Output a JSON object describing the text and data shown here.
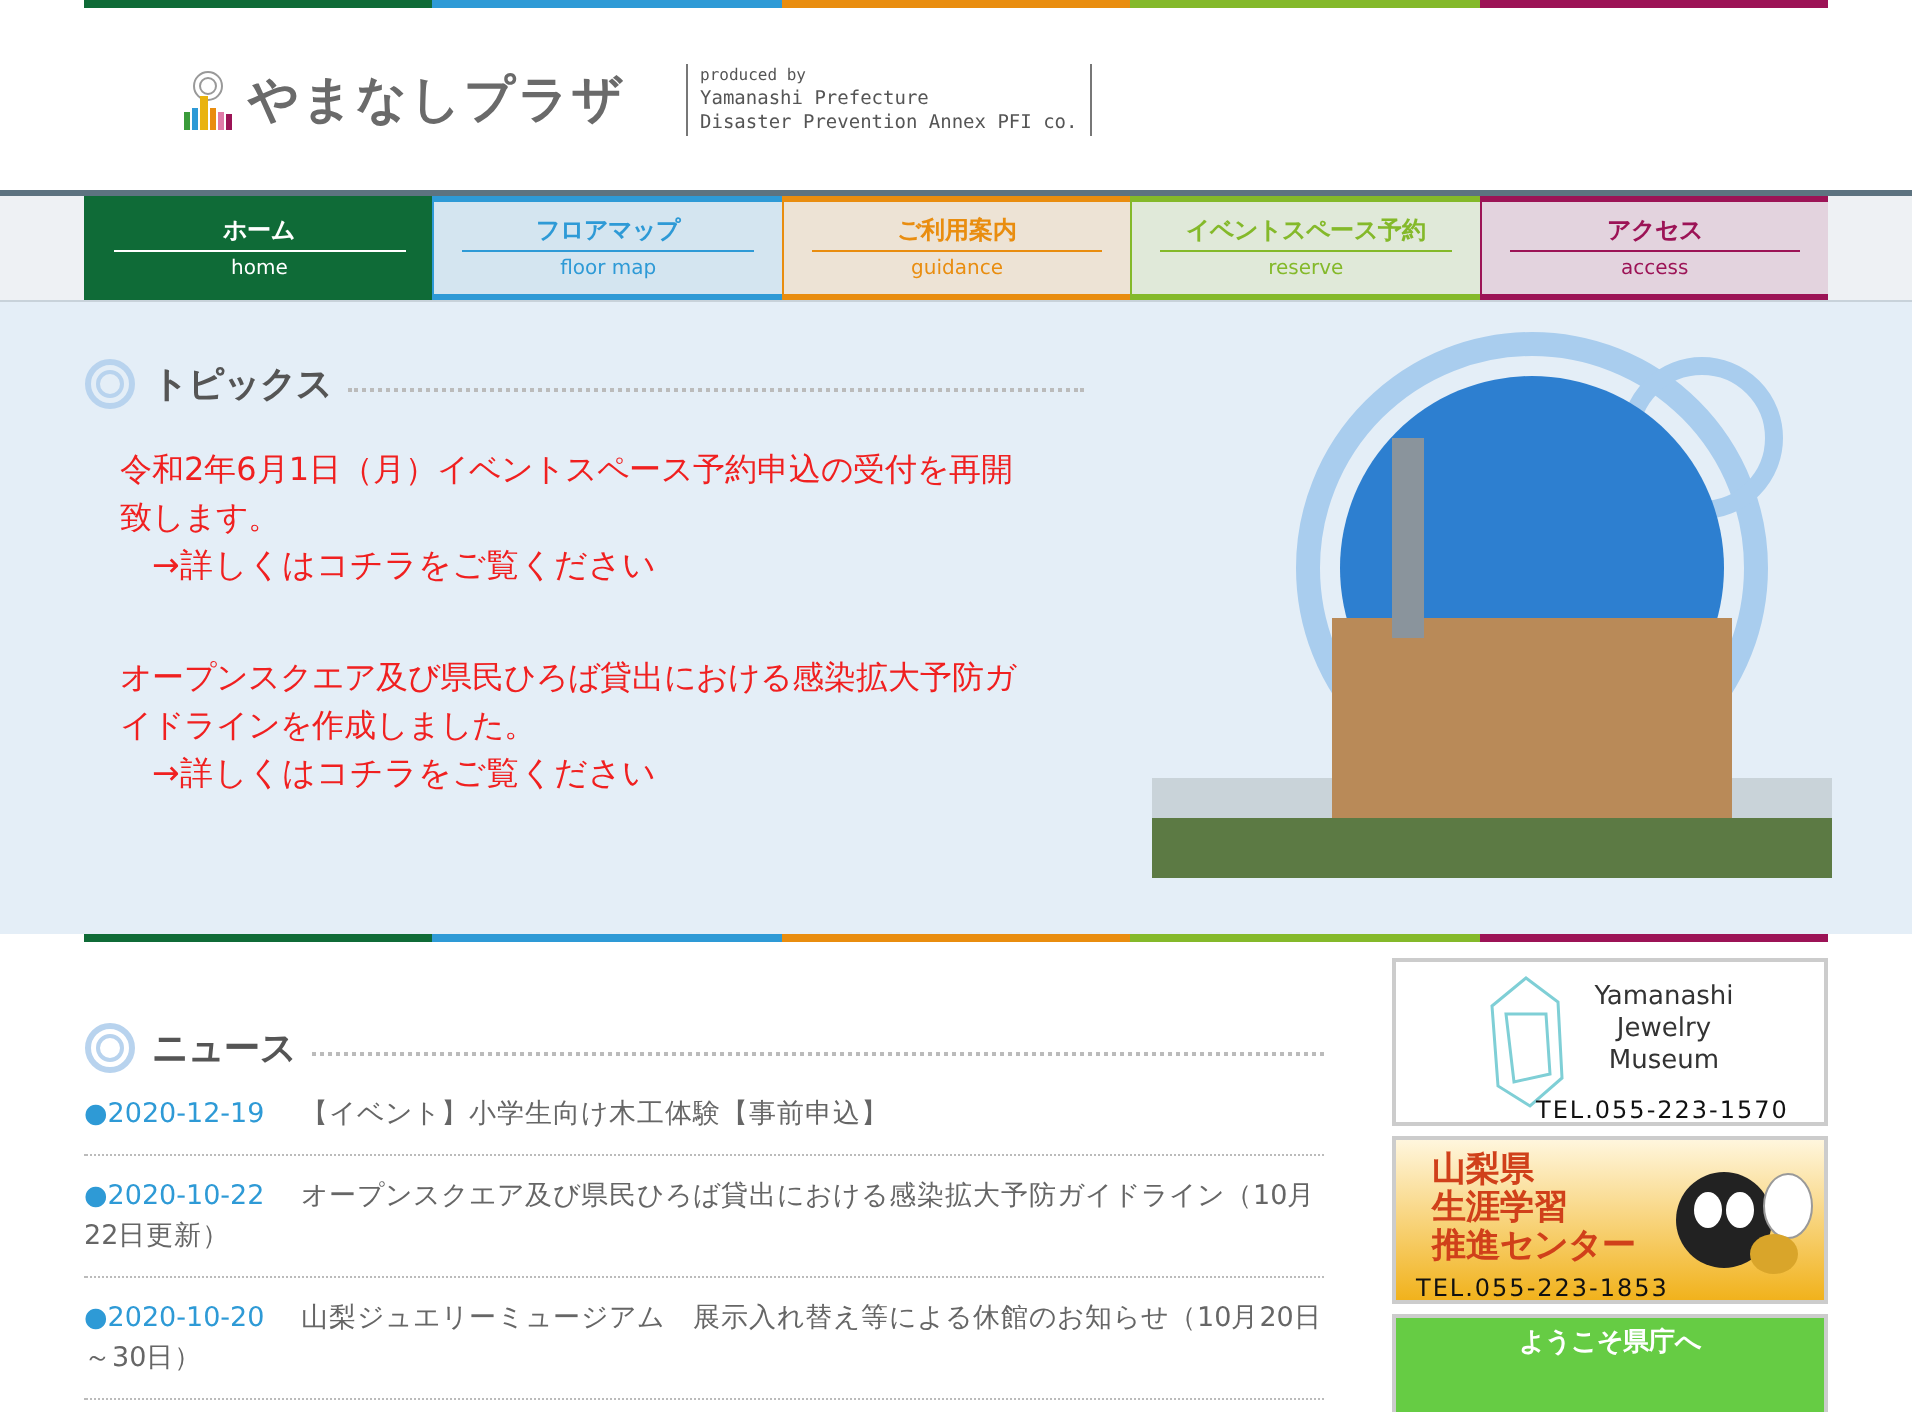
{
  "header": {
    "logo_text": "やまなしプラザ",
    "credit": [
      "produced by",
      "Yamanashi Prefecture",
      "Disaster Prevention Annex PFI co."
    ]
  },
  "nav": [
    {
      "label": "ホーム",
      "sublabel": "home",
      "color": "#0f6b37",
      "selected": true
    },
    {
      "label": "フロアマップ",
      "sublabel": "floor map",
      "color": "#2e9ad6",
      "selected": false
    },
    {
      "label": "ご利用案内",
      "sublabel": "guidance",
      "color": "#e98d0f",
      "selected": false
    },
    {
      "label": "イベントスペース予約",
      "sublabel": "reserve",
      "color": "#84b92a",
      "selected": false
    },
    {
      "label": "アクセス",
      "sublabel": "access",
      "color": "#9c1356",
      "selected": false
    }
  ],
  "topics": {
    "title": "トピックス",
    "items": [
      {
        "text": "令和2年6月1日（月）イベントスペース予約申込の受付を再開致します。",
        "link": "→詳しくはコチラをご覧ください"
      },
      {
        "text": "オープンスクエア及び県民ひろば貸出における感染拡大予防ガイドラインを作成しました。",
        "link": "→詳しくはコチラをご覧ください"
      }
    ]
  },
  "news": {
    "title": "ニュース",
    "items": [
      {
        "date": "●2020-12-19",
        "text": "【イベント】小学生向け木工体験【事前申込】"
      },
      {
        "date": "●2020-10-22",
        "text": "オープンスクエア及び県民ひろば貸出における感染拡大予防ガイドライン（10月22日更新）"
      },
      {
        "date": "●2020-10-20",
        "text": "山梨ジュエリーミュージアム　展示入れ替え等による休館のお知らせ（10月20日～30日）"
      }
    ]
  },
  "banners": [
    {
      "kind": "museum",
      "lines": [
        "Yamanashi",
        "Jewelry",
        "Museum"
      ],
      "tel": "TEL.055-223-1570"
    },
    {
      "kind": "learning",
      "lines": [
        "山梨県",
        "生涯学習",
        "推進センター"
      ],
      "tel": "TEL.055-223-1853"
    },
    {
      "kind": "prefecture",
      "lines": [
        "ようこそ県庁へ"
      ]
    }
  ]
}
